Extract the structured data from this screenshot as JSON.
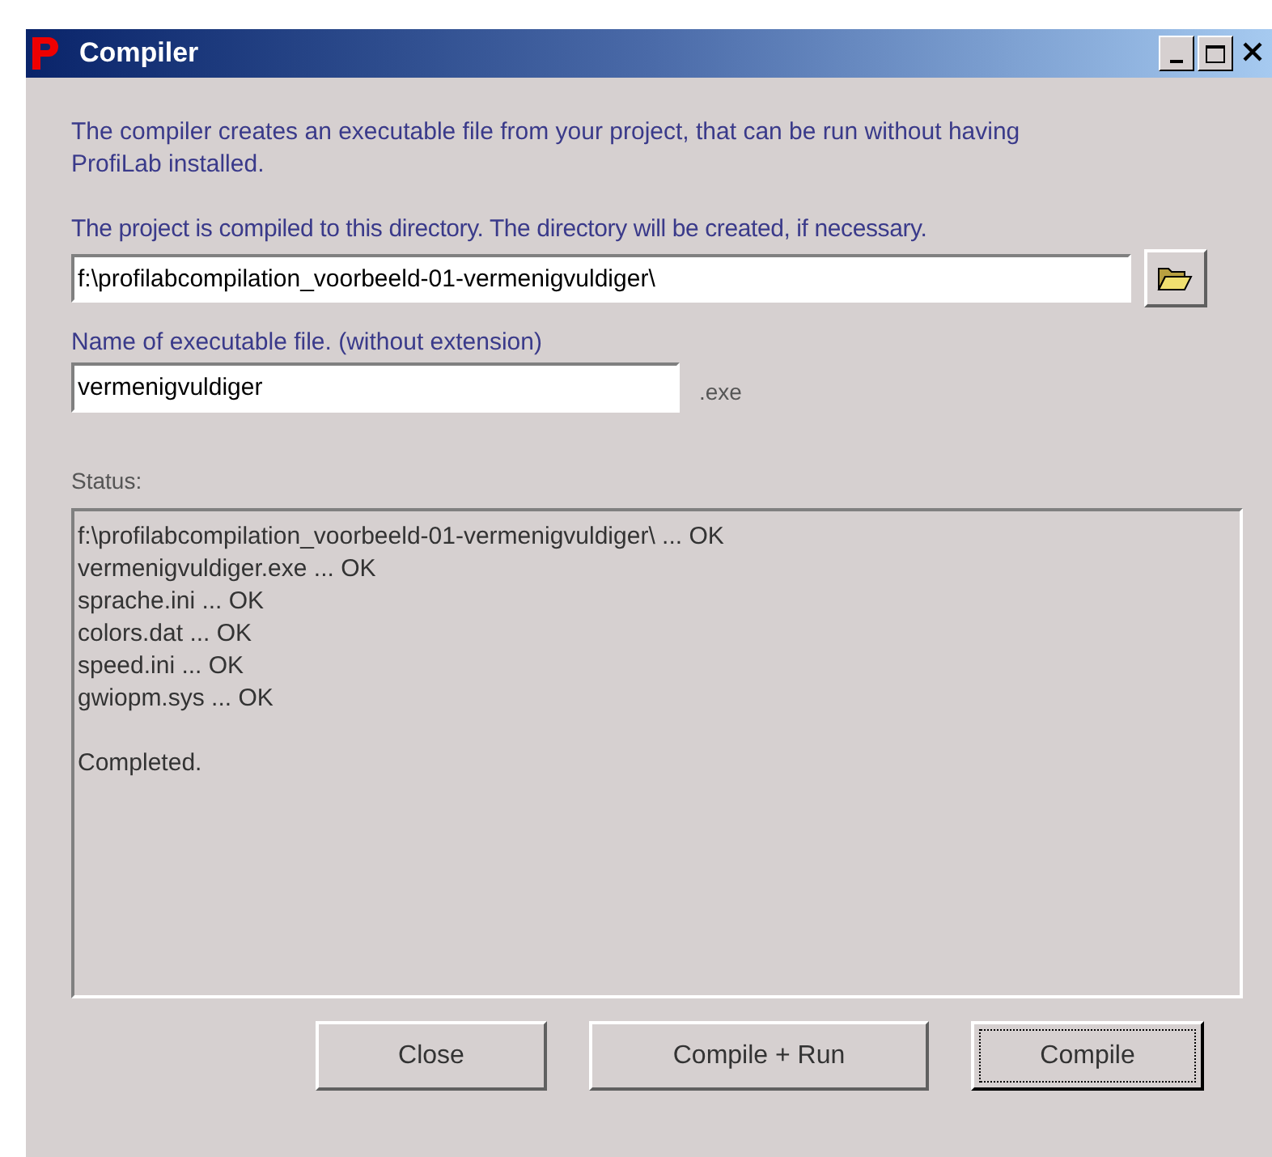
{
  "window": {
    "title": "Compiler"
  },
  "intro": "The compiler creates an executable file from your project, that can be run without having ProfiLab installed.",
  "directory": {
    "label": "The project is compiled to this directory. The directory will be created, if necessary.",
    "value": "f:\\profilabcompilation_voorbeeld-01-vermenigvuldiger\\"
  },
  "executable": {
    "label": "Name of executable file. (without extension)",
    "value": "vermenigvuldiger",
    "extension": ".exe"
  },
  "status": {
    "label": "Status:",
    "lines": [
      "f:\\profilabcompilation_voorbeeld-01-vermenigvuldiger\\ ... OK",
      "vermenigvuldiger.exe ... OK",
      "sprache.ini ... OK",
      "colors.dat ... OK",
      "speed.ini ... OK",
      "gwiopm.sys ... OK"
    ],
    "result": "Completed."
  },
  "buttons": [
    {
      "label": "Close",
      "default": false
    },
    {
      "label": "Compile + Run",
      "default": false
    },
    {
      "label": "Compile",
      "default": true
    }
  ]
}
